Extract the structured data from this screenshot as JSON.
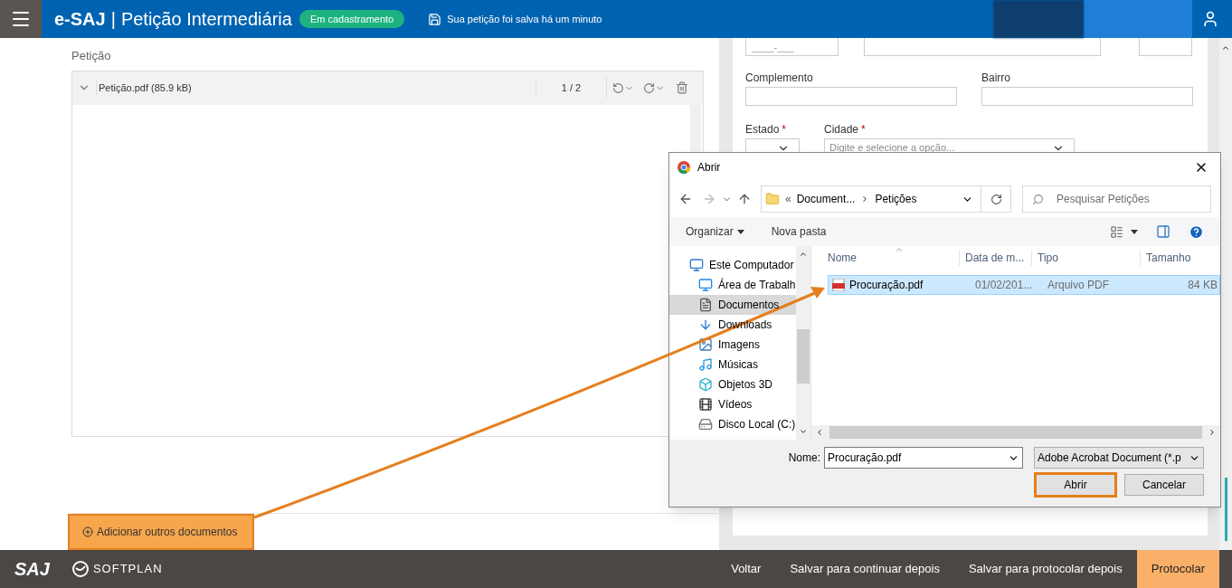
{
  "header": {
    "brand": "e-SAJ",
    "separator": "|",
    "title": "Petição Intermediária",
    "status_badge": "Em cadastramento",
    "save_notice": "Sua petição foi salva há um minuto"
  },
  "petition": {
    "section_label": "Petição",
    "document": {
      "name": "Petição.pdf (85.9 kB)",
      "expanded": true,
      "pages": "1 / 2"
    },
    "add_button": {
      "label": "Adicionar outros documentos",
      "highlighted": true
    }
  },
  "address_form": {
    "cep_placeholder": "____-___",
    "fields": [
      {
        "label": "Complemento"
      },
      {
        "label": "Bairro"
      }
    ],
    "estado": {
      "label": "Estado",
      "required_mark": "*"
    },
    "cidade": {
      "label": "Cidade",
      "required_mark": "*",
      "placeholder": "Digite e selecione a opção..."
    }
  },
  "dialog": {
    "title": "Abrir",
    "path_overflow": "«",
    "path": [
      "Document...",
      "Petições"
    ],
    "search_placeholder": "Pesquisar Petições",
    "toolbar": [
      "Organizar",
      "Nova pasta"
    ],
    "nav_items": [
      {
        "label": "Este Computador",
        "kind": "computer",
        "selected": false,
        "children": [
          {
            "label": "Área de Trabalh",
            "kind": "desktop",
            "selected": false
          },
          {
            "label": "Documentos",
            "kind": "documents",
            "selected": true
          },
          {
            "label": "Downloads",
            "kind": "downloads",
            "selected": false
          },
          {
            "label": "Imagens",
            "kind": "images",
            "selected": false
          },
          {
            "label": "Músicas",
            "kind": "music",
            "selected": false
          },
          {
            "label": "Objetos 3D",
            "kind": "objects",
            "selected": false
          },
          {
            "label": "Vídeos",
            "kind": "videos",
            "selected": false
          },
          {
            "label": "Disco Local (C:)",
            "kind": "disk",
            "selected": false
          }
        ]
      }
    ],
    "columns": [
      "Nome",
      "Data de m...",
      "Tipo",
      "Tamanho"
    ],
    "files": [
      {
        "name": "Procuração.pdf",
        "date": "01/02/201...",
        "type": "Arquivo PDF",
        "size": "84 KB",
        "selected": true
      }
    ],
    "filename_label": "Nome:",
    "filename_value": "Procuração.pdf",
    "filter": "Adobe Acrobat Document (*.p",
    "buttons": [
      {
        "label": "Abrir",
        "highlighted": true
      },
      {
        "label": "Cancelar",
        "highlighted": false
      }
    ]
  },
  "footer": {
    "logos": [
      "SAJ",
      "SOFTPLAN"
    ],
    "actions": [
      {
        "label": "Voltar",
        "primary": false
      },
      {
        "label": "Salvar para continuar depois",
        "primary": false
      },
      {
        "label": "Salvar para protocolar depois",
        "primary": false
      },
      {
        "label": "Protocolar",
        "primary": true
      }
    ]
  }
}
